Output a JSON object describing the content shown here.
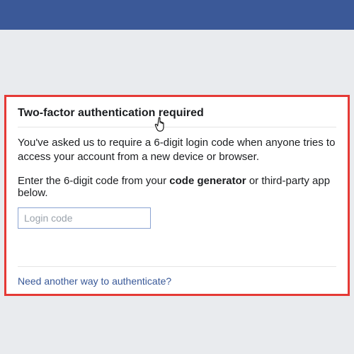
{
  "colors": {
    "brand": "#3b5998",
    "link": "#385898",
    "highlight": "#e53935"
  },
  "card": {
    "title": "Two-factor authentication required",
    "desc_line1": "You've asked us to require a 6-digit login code when anyone tries to access your account from a new device or browser.",
    "desc2_prefix": "Enter the 6-digit code from your ",
    "desc2_bold": "code generator",
    "desc2_suffix": " or third-party app below.",
    "input_placeholder": "Login code",
    "input_value": "",
    "help_link": "Need another way to authenticate?"
  }
}
